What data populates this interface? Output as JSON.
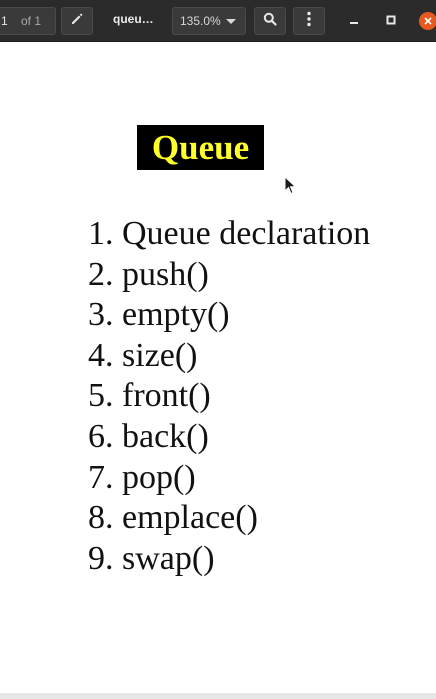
{
  "toolbar": {
    "page_current": "1",
    "page_total_label": "of 1",
    "document_title": "queu…",
    "zoom": "135.0%",
    "icons": {
      "edit": "pencil-icon",
      "search": "search-icon",
      "menu": "more-vertical-icon",
      "minimize": "minimize-icon",
      "maximize": "maximize-icon",
      "close": "close-icon"
    },
    "close_color": "#e65a1f"
  },
  "page": {
    "heading": "Queue",
    "heading_bg": "#000000",
    "heading_color": "#ffff2b",
    "items": [
      {
        "num": "1.",
        "text": "Queue declaration"
      },
      {
        "num": "2.",
        "text": "push()"
      },
      {
        "num": "3.",
        "text": "empty()"
      },
      {
        "num": "4.",
        "text": "size()"
      },
      {
        "num": "5.",
        "text": "front()"
      },
      {
        "num": "6.",
        "text": "back()"
      },
      {
        "num": "7.",
        "text": "pop()"
      },
      {
        "num": "8.",
        "text": "emplace()"
      },
      {
        "num": "9.",
        "text": "swap()"
      }
    ]
  }
}
